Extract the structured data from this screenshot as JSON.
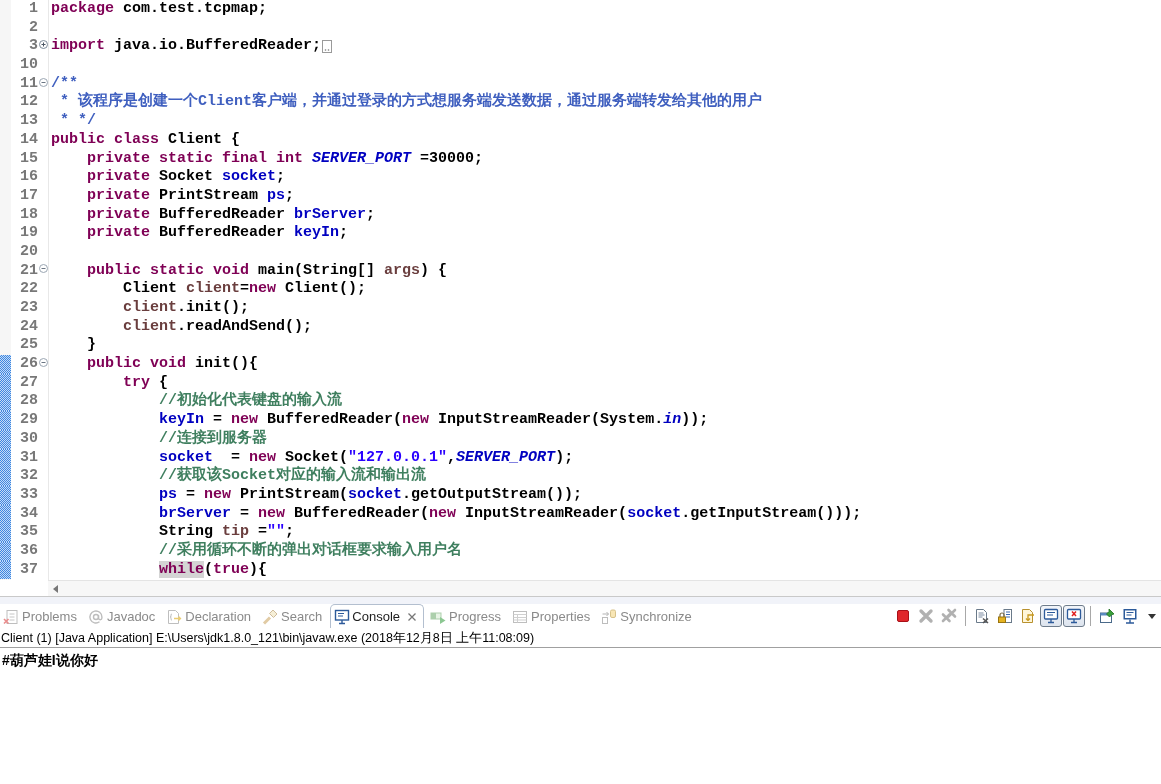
{
  "editor": {
    "lines": [
      {
        "number": "1",
        "changed": false,
        "tokens": [
          {
            "kind": "keyword",
            "text": "package"
          },
          {
            "kind": "plain",
            "text": " com.test.tcpmap;"
          }
        ]
      },
      {
        "number": "2",
        "changed": false
      },
      {
        "number": "3",
        "changed": false,
        "expanded": false,
        "tokens": [
          {
            "kind": "keyword",
            "text": "import"
          },
          {
            "kind": "plain",
            "text": " java.io.BufferedReader;"
          }
        ]
      },
      {
        "number": "10",
        "changed": false
      },
      {
        "number": "11",
        "changed": false,
        "expanded": true,
        "tokens": [
          {
            "kind": "javadoc",
            "text": "/**"
          }
        ]
      },
      {
        "number": "12",
        "changed": false,
        "tokens": [
          {
            "kind": "javadoc",
            "text": " * 该程序是创建一个Client客户端，并通过登录的方式想服务端发送数据，通过服务端转发给其他的用户"
          }
        ]
      },
      {
        "number": "13",
        "changed": false,
        "tokens": [
          {
            "kind": "javadoc",
            "text": " * */"
          }
        ]
      },
      {
        "number": "14",
        "changed": false,
        "tokens": [
          {
            "kind": "keyword",
            "text": "public class"
          },
          {
            "kind": "plain",
            "text": " Client {"
          }
        ],
        "children": [
          {
            "number": "15",
            "changed": false,
            "tokens": [
              {
                "kind": "keyword",
                "text": "private static final int "
              },
              {
                "kind": "constant",
                "text": "SERVER_PORT"
              },
              {
                "kind": "plain",
                "text": " =30000;"
              }
            ]
          },
          {
            "number": "16",
            "changed": false,
            "tokens": [
              {
                "kind": "keyword",
                "text": "private "
              },
              {
                "kind": "plain",
                "text": "Socket "
              },
              {
                "kind": "field",
                "text": "socket"
              },
              {
                "kind": "plain",
                "text": ";"
              }
            ]
          },
          {
            "number": "17",
            "changed": false,
            "tokens": [
              {
                "kind": "keyword",
                "text": "private "
              },
              {
                "kind": "plain",
                "text": "PrintStream "
              },
              {
                "kind": "field",
                "text": "ps"
              },
              {
                "kind": "plain",
                "text": ";"
              }
            ]
          },
          {
            "number": "18",
            "changed": false,
            "tokens": [
              {
                "kind": "keyword",
                "text": "private "
              },
              {
                "kind": "plain",
                "text": "BufferedReader "
              },
              {
                "kind": "field",
                "text": "brServer"
              },
              {
                "kind": "plain",
                "text": ";"
              }
            ]
          },
          {
            "number": "19",
            "changed": false,
            "tokens": [
              {
                "kind": "keyword",
                "text": "private "
              },
              {
                "kind": "plain",
                "text": "BufferedReader "
              },
              {
                "kind": "field",
                "text": "keyIn"
              },
              {
                "kind": "plain",
                "text": ";"
              }
            ]
          },
          {
            "number": "20",
            "changed": false
          },
          {
            "number": "21",
            "changed": false,
            "expanded": true,
            "tokens": [
              {
                "kind": "keyword",
                "text": "public static void "
              },
              {
                "kind": "plain",
                "text": "main(String[] "
              },
              {
                "kind": "local",
                "text": "args"
              },
              {
                "kind": "plain",
                "text": ") {"
              }
            ],
            "children": [
              {
                "number": "22",
                "changed": false,
                "tokens": [
                  {
                    "kind": "plain",
                    "text": "Client "
                  },
                  {
                    "kind": "local",
                    "text": "client"
                  },
                  {
                    "kind": "plain",
                    "text": "="
                  },
                  {
                    "kind": "keyword",
                    "text": "new"
                  },
                  {
                    "kind": "plain",
                    "text": " Client();"
                  }
                ]
              },
              {
                "number": "23",
                "changed": false,
                "tokens": [
                  {
                    "kind": "local",
                    "text": "client"
                  },
                  {
                    "kind": "plain",
                    "text": ".init();"
                  }
                ]
              },
              {
                "number": "24",
                "changed": false,
                "tokens": [
                  {
                    "kind": "local",
                    "text": "client"
                  },
                  {
                    "kind": "plain",
                    "text": ".readAndSend();"
                  }
                ]
              }
            ]
          },
          {
            "number": "25",
            "changed": false,
            "tokens": [
              {
                "kind": "plain",
                "text": "}"
              }
            ]
          },
          {
            "number": "26",
            "changed": true,
            "expanded": true,
            "tokens": [
              {
                "kind": "keyword",
                "text": "public void "
              },
              {
                "kind": "plain",
                "text": "init(){"
              }
            ],
            "children": [
              {
                "number": "27",
                "changed": true,
                "tokens": [
                  {
                    "kind": "keyword",
                    "text": "try"
                  },
                  {
                    "kind": "plain",
                    "text": " {"
                  }
                ],
                "children": [
                  {
                    "number": "28",
                    "changed": true,
                    "tokens": [
                      {
                        "kind": "comment",
                        "text": "//初始化代表键盘的输入流"
                      }
                    ]
                  },
                  {
                    "number": "29",
                    "changed": true,
                    "tokens": [
                      {
                        "kind": "field",
                        "text": "keyIn"
                      },
                      {
                        "kind": "plain",
                        "text": " = "
                      },
                      {
                        "kind": "keyword",
                        "text": "new"
                      },
                      {
                        "kind": "plain",
                        "text": " BufferedReader("
                      },
                      {
                        "kind": "keyword",
                        "text": "new"
                      },
                      {
                        "kind": "plain",
                        "text": " InputStreamReader(System."
                      },
                      {
                        "kind": "constant",
                        "text": "in"
                      },
                      {
                        "kind": "plain",
                        "text": "));"
                      }
                    ]
                  },
                  {
                    "number": "30",
                    "changed": true,
                    "tokens": [
                      {
                        "kind": "comment",
                        "text": "//连接到服务器"
                      }
                    ]
                  },
                  {
                    "number": "31",
                    "changed": true,
                    "tokens": [
                      {
                        "kind": "field",
                        "text": "socket"
                      },
                      {
                        "kind": "plain",
                        "text": "  = "
                      },
                      {
                        "kind": "keyword",
                        "text": "new"
                      },
                      {
                        "kind": "plain",
                        "text": " Socket("
                      },
                      {
                        "kind": "string",
                        "text": "\"127.0.0.1\""
                      },
                      {
                        "kind": "plain",
                        "text": ","
                      },
                      {
                        "kind": "constant",
                        "text": "SERVER_PORT"
                      },
                      {
                        "kind": "plain",
                        "text": ");"
                      }
                    ]
                  },
                  {
                    "number": "32",
                    "changed": true,
                    "tokens": [
                      {
                        "kind": "comment",
                        "text": "//获取该Socket对应的输入流和输出流"
                      }
                    ]
                  },
                  {
                    "number": "33",
                    "changed": true,
                    "tokens": [
                      {
                        "kind": "field",
                        "text": "ps"
                      },
                      {
                        "kind": "plain",
                        "text": " = "
                      },
                      {
                        "kind": "keyword",
                        "text": "new"
                      },
                      {
                        "kind": "plain",
                        "text": " PrintStream("
                      },
                      {
                        "kind": "field",
                        "text": "socket"
                      },
                      {
                        "kind": "plain",
                        "text": ".getOutputStream());"
                      }
                    ]
                  },
                  {
                    "number": "34",
                    "changed": true,
                    "tokens": [
                      {
                        "kind": "field",
                        "text": "brServer"
                      },
                      {
                        "kind": "plain",
                        "text": " = "
                      },
                      {
                        "kind": "keyword",
                        "text": "new"
                      },
                      {
                        "kind": "plain",
                        "text": " BufferedReader("
                      },
                      {
                        "kind": "keyword",
                        "text": "new"
                      },
                      {
                        "kind": "plain",
                        "text": " InputStreamReader("
                      },
                      {
                        "kind": "field",
                        "text": "socket"
                      },
                      {
                        "kind": "plain",
                        "text": ".getInputStream()));"
                      }
                    ]
                  },
                  {
                    "number": "35",
                    "changed": true,
                    "tokens": [
                      {
                        "kind": "plain",
                        "text": "String "
                      },
                      {
                        "kind": "local",
                        "text": "tip"
                      },
                      {
                        "kind": "plain",
                        "text": " ="
                      },
                      {
                        "kind": "string",
                        "text": "\"\""
                      },
                      {
                        "kind": "plain",
                        "text": ";"
                      }
                    ]
                  },
                  {
                    "number": "36",
                    "changed": true,
                    "tokens": [
                      {
                        "kind": "comment",
                        "text": "//采用循环不断的弹出对话框要求输入用户名"
                      }
                    ]
                  },
                  {
                    "number": "37",
                    "changed": true,
                    "tokens": [
                      {
                        "kind": "occurrence",
                        "text": "while"
                      },
                      {
                        "kind": "plain",
                        "text": "("
                      },
                      {
                        "kind": "keyword",
                        "text": "true"
                      },
                      {
                        "kind": "plain",
                        "text": "){"
                      }
                    ]
                  }
                ]
              }
            ]
          }
        ]
      }
    ]
  },
  "views": {
    "tabs": [
      {
        "label": "Problems",
        "selected": false
      },
      {
        "label": "Javadoc",
        "selected": false
      },
      {
        "label": "Declaration",
        "selected": false
      },
      {
        "label": "Search",
        "selected": false
      },
      {
        "label": "Console",
        "selected": true
      },
      {
        "label": "Progress",
        "selected": false
      },
      {
        "label": "Properties",
        "selected": false
      },
      {
        "label": "Synchronize",
        "selected": false
      }
    ],
    "toolbar_groups": [
      [
        {
          "disabled": false,
          "pressed": false
        },
        {
          "disabled": true,
          "pressed": false
        },
        {
          "disabled": true,
          "pressed": false
        }
      ],
      [
        {
          "disabled": false,
          "pressed": false
        },
        {
          "disabled": false,
          "pressed": false
        },
        {
          "disabled": false,
          "pressed": false
        },
        {
          "disabled": false,
          "pressed": true
        },
        {
          "disabled": false,
          "pressed": true
        }
      ],
      [
        {
          "disabled": false,
          "pressed": false
        },
        {
          "disabled": false,
          "pressed": false
        }
      ]
    ]
  },
  "console": {
    "launch_info": "Client (1) [Java Application] E:\\Users\\jdk1.8.0_121\\bin\\javaw.exe (2018年12月8日 上午11:08:09)",
    "output": [
      "#葫芦娃I说你好"
    ]
  }
}
